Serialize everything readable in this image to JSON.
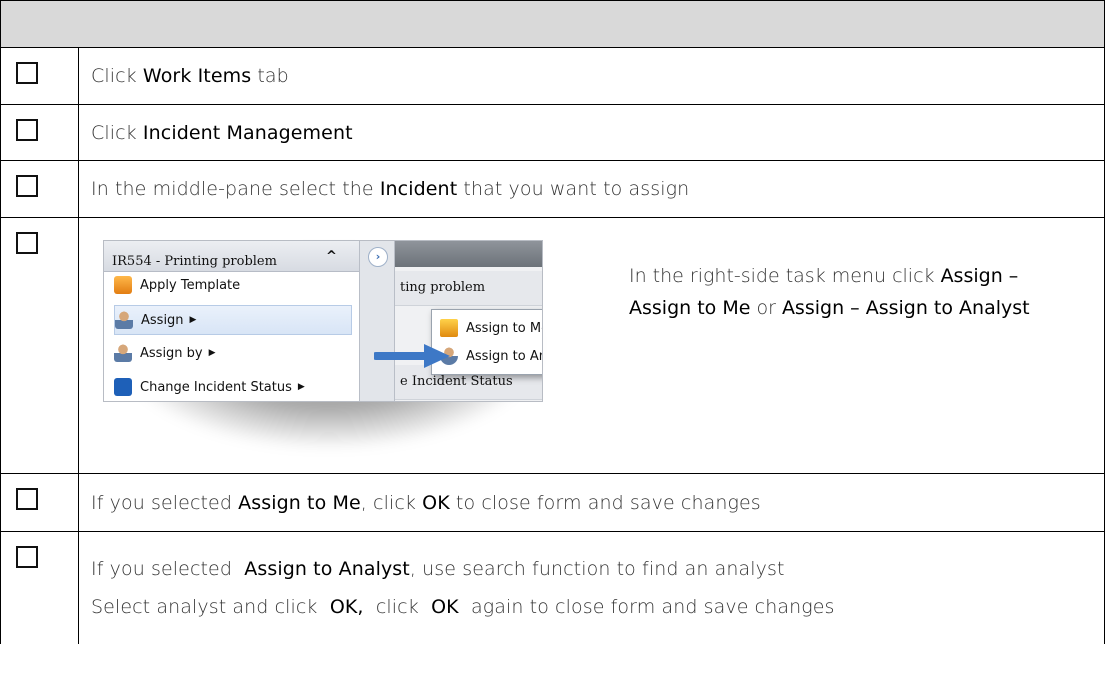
{
  "rows": [
    {
      "parts": [
        {
          "t": "Click "
        },
        {
          "t": "Work Items",
          "hl": true
        },
        {
          "t": " tab"
        }
      ]
    },
    {
      "parts": [
        {
          "t": "Click "
        },
        {
          "t": "Incident Management",
          "hl": true
        }
      ]
    },
    {
      "parts": [
        {
          "t": "In the middle-pane select the "
        },
        {
          "t": "Incident",
          "hl": true
        },
        {
          "t": " that you want to assign"
        }
      ]
    },
    {
      "screenshot": {
        "title": "IR554 - Printing problem",
        "items": [
          "Apply Template",
          "Assign",
          "Assign by",
          "Change Incident Status"
        ],
        "right_items": [
          "ting problem",
          "e Incident Status"
        ],
        "submenu": [
          "Assign to Me",
          "Assign to Analyst"
        ]
      },
      "parts": [
        {
          "t": "In the right-side task menu click "
        },
        {
          "t": "Assign – Assign to Me",
          "hl": true
        },
        {
          "t": " or "
        },
        {
          "t": "Assign – Assign to Analyst",
          "hl": true
        }
      ]
    },
    {
      "parts": [
        {
          "t": "If you selected "
        },
        {
          "t": "Assign to Me",
          "hl": true
        },
        {
          "t": ", click "
        },
        {
          "t": "OK",
          "hl": true
        },
        {
          "t": " to close form and save changes"
        }
      ]
    },
    {
      "line1": [
        {
          "t": "If you selected "
        },
        {
          "t": "Assign to Analyst",
          "hl": true
        },
        {
          "t": ", use search function to find an analyst"
        }
      ],
      "line2": [
        {
          "t": "Select analyst and click "
        },
        {
          "t": "OK,",
          "hl": true
        },
        {
          "t": " click "
        },
        {
          "t": "OK",
          "hl": true
        },
        {
          "t": " again to close form and save changes"
        }
      ]
    }
  ],
  "colors": {
    "header_bg": "#d9d9d9",
    "arrow": "#3d78c6"
  },
  "icons": [
    "checkbox-icon",
    "template-icon",
    "person-icon",
    "info-icon",
    "assign-me-icon"
  ]
}
